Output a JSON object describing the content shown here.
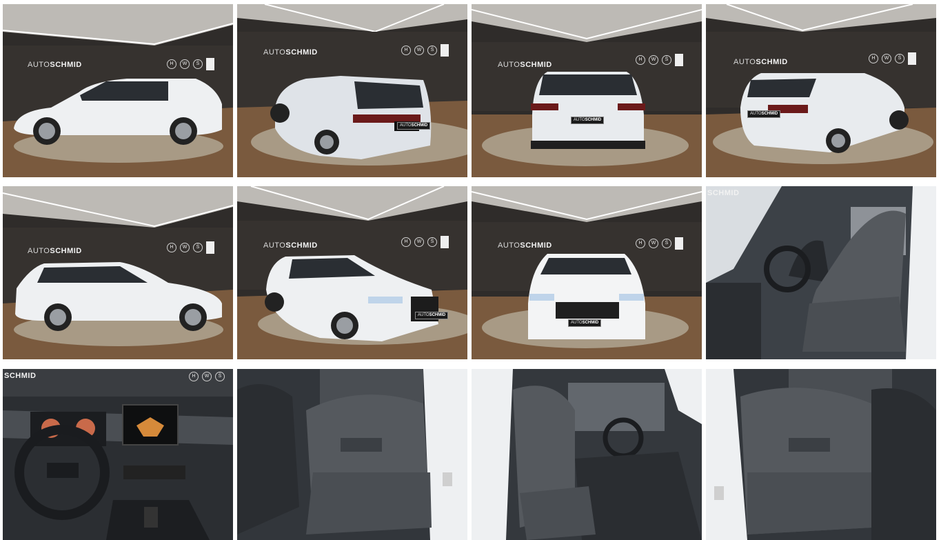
{
  "gallery": {
    "dealer_logo": {
      "prefix": "AUTO",
      "name": "SCHMID"
    },
    "plate_text": {
      "prefix": "AUTO",
      "name": "SCHMID"
    },
    "brands": [
      "H",
      "W",
      "Š"
    ],
    "photos": [
      {
        "view": "side-left",
        "type": "showroom"
      },
      {
        "view": "rear-three-quarter-left",
        "type": "showroom"
      },
      {
        "view": "rear",
        "type": "showroom"
      },
      {
        "view": "rear-three-quarter-right",
        "type": "showroom"
      },
      {
        "view": "side-right",
        "type": "showroom"
      },
      {
        "view": "front-three-quarter",
        "type": "showroom"
      },
      {
        "view": "front",
        "type": "showroom"
      },
      {
        "view": "front-seats",
        "type": "interior"
      },
      {
        "view": "dashboard",
        "type": "interior"
      },
      {
        "view": "rear-seats-left",
        "type": "interior"
      },
      {
        "view": "front-seats-driver",
        "type": "interior"
      },
      {
        "view": "rear-seats-right",
        "type": "interior"
      }
    ]
  }
}
